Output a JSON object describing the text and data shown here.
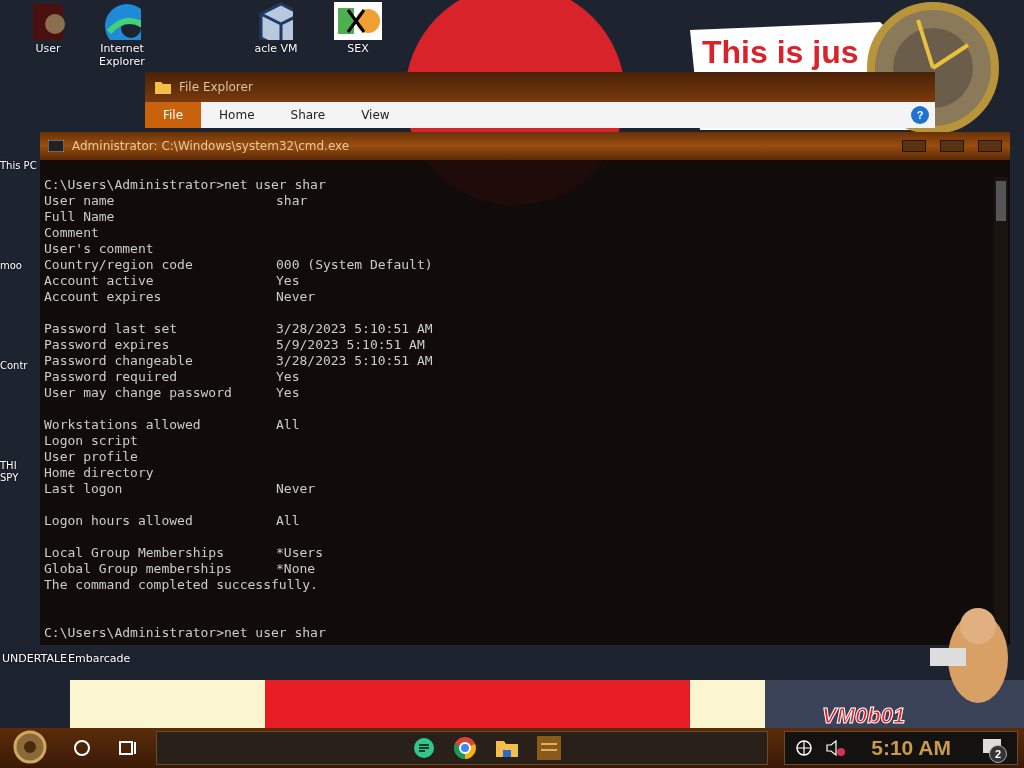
{
  "desktop_icons": [
    {
      "label": "User",
      "kind": "person"
    },
    {
      "label": "Internet Explorer",
      "kind": "browser"
    },
    {
      "label": "acle VM",
      "kind": "cube"
    },
    {
      "label": "SEX",
      "kind": "hex"
    }
  ],
  "side_labels": [
    "This PC",
    "moo",
    "Contr",
    "THI SPY"
  ],
  "bottom_labels": [
    "UNDERTALE",
    "Embarcade"
  ],
  "wallpaper": {
    "sign": "This is jus",
    "tag": "VM0b01"
  },
  "explorer": {
    "title": "File Explorer",
    "tabs": [
      {
        "label": "File",
        "selected": true
      },
      {
        "label": "Home",
        "selected": false
      },
      {
        "label": "Share",
        "selected": false
      },
      {
        "label": "View",
        "selected": false
      }
    ],
    "help": "?"
  },
  "cmd": {
    "title": "Administrator: C:\\Windows\\system32\\cmd.exe",
    "lines": [
      {
        "kind": "prompt",
        "text": "C:\\Users\\Administrator>net user shar"
      },
      {
        "kind": "field",
        "label": "User name",
        "value": "shar"
      },
      {
        "kind": "field",
        "label": "Full Name"
      },
      {
        "kind": "field",
        "label": "Comment"
      },
      {
        "kind": "field",
        "label": "User's comment"
      },
      {
        "kind": "field",
        "label": "Country/region code",
        "value": "000 (System Default)"
      },
      {
        "kind": "field",
        "label": "Account active",
        "value": "Yes"
      },
      {
        "kind": "field",
        "label": "Account expires",
        "value": "Never"
      },
      {
        "kind": "blank"
      },
      {
        "kind": "field",
        "label": "Password last set",
        "value": "3/28/2023 5:10:51 AM"
      },
      {
        "kind": "field",
        "label": "Password expires",
        "value": "5/9/2023 5:10:51 AM"
      },
      {
        "kind": "field",
        "label": "Password changeable",
        "value": "3/28/2023 5:10:51 AM"
      },
      {
        "kind": "field",
        "label": "Password required",
        "value": "Yes"
      },
      {
        "kind": "field",
        "label": "User may change password",
        "value": "Yes"
      },
      {
        "kind": "blank"
      },
      {
        "kind": "field",
        "label": "Workstations allowed",
        "value": "All"
      },
      {
        "kind": "field",
        "label": "Logon script"
      },
      {
        "kind": "field",
        "label": "User profile"
      },
      {
        "kind": "field",
        "label": "Home directory"
      },
      {
        "kind": "field",
        "label": "Last logon",
        "value": "Never"
      },
      {
        "kind": "blank"
      },
      {
        "kind": "field",
        "label": "Logon hours allowed",
        "value": "All"
      },
      {
        "kind": "blank"
      },
      {
        "kind": "field",
        "label": "Local Group Memberships",
        "value": "*Users"
      },
      {
        "kind": "field",
        "label": "Global Group memberships",
        "value": "*None"
      },
      {
        "kind": "text",
        "text": "The command completed successfully."
      },
      {
        "kind": "blank"
      },
      {
        "kind": "blank"
      },
      {
        "kind": "prompt",
        "text": "C:\\Users\\Administrator>net user shar"
      }
    ]
  },
  "taskbar": {
    "apps": [
      {
        "kind": "chat"
      },
      {
        "kind": "chrome"
      },
      {
        "kind": "folder"
      },
      {
        "kind": "tile"
      }
    ],
    "time": "5:10 AM",
    "notifications": "2"
  }
}
